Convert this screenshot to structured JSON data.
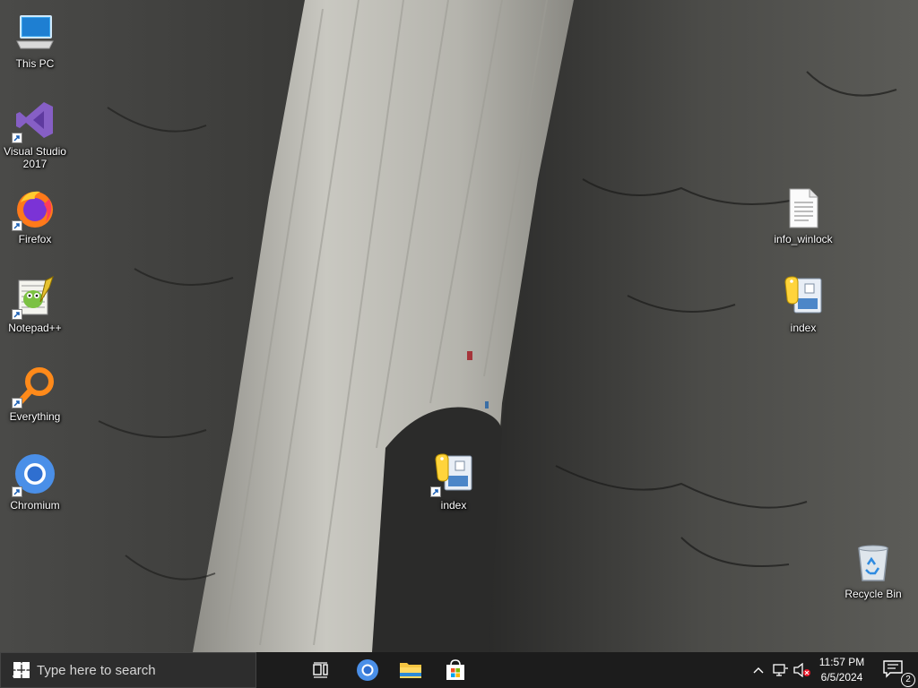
{
  "desktop": {
    "icons": [
      {
        "label": "This PC",
        "icon": "computer-icon"
      },
      {
        "label": "Visual Studio 2017",
        "label_line1": "Visual Studio",
        "label_line2": "2017",
        "icon": "visual-studio-icon"
      },
      {
        "label": "Firefox",
        "icon": "firefox-icon"
      },
      {
        "label": "Notepad++",
        "icon": "notepadpp-icon"
      },
      {
        "label": "Everything",
        "icon": "everything-search-icon"
      },
      {
        "label": "Chromium",
        "icon": "chromium-icon"
      },
      {
        "label": "info_winlock",
        "icon": "text-file-icon"
      },
      {
        "label": "index",
        "icon": "python-file-icon"
      },
      {
        "label": "index",
        "icon": "python-file-shortcut-icon"
      },
      {
        "label": "Recycle Bin",
        "icon": "recycle-bin-icon"
      }
    ]
  },
  "taskbar": {
    "search_placeholder": "Type here to search",
    "pinned": [
      "task-view-icon",
      "chromium-icon",
      "file-explorer-icon",
      "microsoft-store-icon"
    ],
    "tray": {
      "time": "11:57 PM",
      "date": "6/5/2024",
      "notification_count": "2"
    }
  },
  "colors": {
    "taskbar": "#1c1c1c",
    "search_box": "#2d2d2d",
    "accent": "#0078d7"
  }
}
